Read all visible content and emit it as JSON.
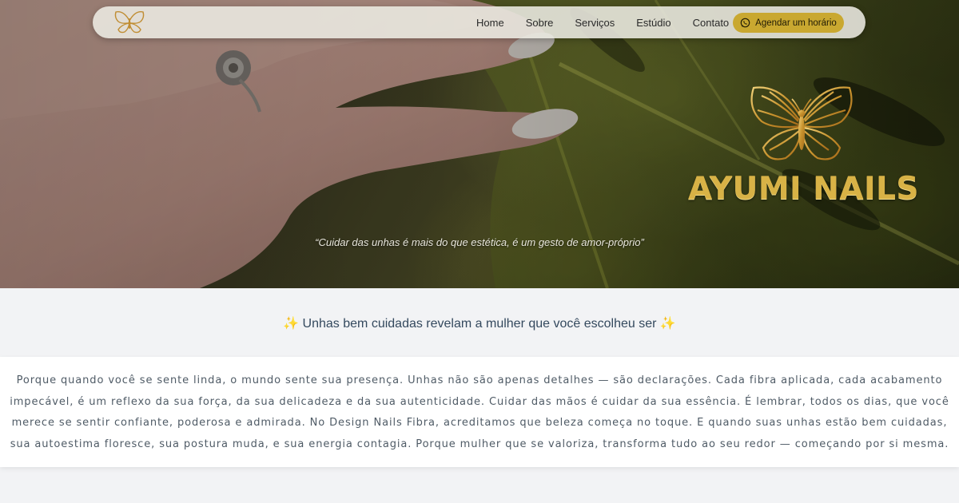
{
  "nav": {
    "logo_icon": "butterfly-logo-icon",
    "links": [
      "Home",
      "Sobre",
      "Serviços",
      "Estúdio",
      "Contato"
    ],
    "cta_label": "Agendar um horário",
    "cta_icon": "whatsapp-icon"
  },
  "hero": {
    "brand_icon": "butterfly-icon",
    "brand_name": "AYUMI NAILS",
    "tagline": "“Cuidar das unhas é mais do que estética, é um gesto de amor-próprio”"
  },
  "headline": {
    "text": "Unhas bem cuidadas revelam a mulher que você escolheu ser",
    "icon_left": "✨",
    "icon_right": "✨"
  },
  "body": {
    "paragraph": "Porque quando você se sente linda, o mundo sente sua presença. Unhas não são apenas detalhes — são declarações. Cada fibra aplicada, cada acabamento impecável, é um reflexo da sua força, da sua delicadeza e da sua autenticidade. Cuidar das mãos é cuidar da sua essência. É lembrar, todos os dias, que você merece se sentir confiante, poderosa e admirada. No Design Nails Fibra, acreditamos que beleza começa no toque. E quando suas unhas estão bem cuidadas, sua autoestima floresce, sua postura muda, e sua energia contagia. Porque mulher que se valoriza, transforma tudo ao seu redor — começando por si mesma."
  },
  "colors": {
    "gold": "#d8b246",
    "cta_bg": "#c9a830",
    "text_dark": "#34495e",
    "text_body": "#4f5b66"
  }
}
